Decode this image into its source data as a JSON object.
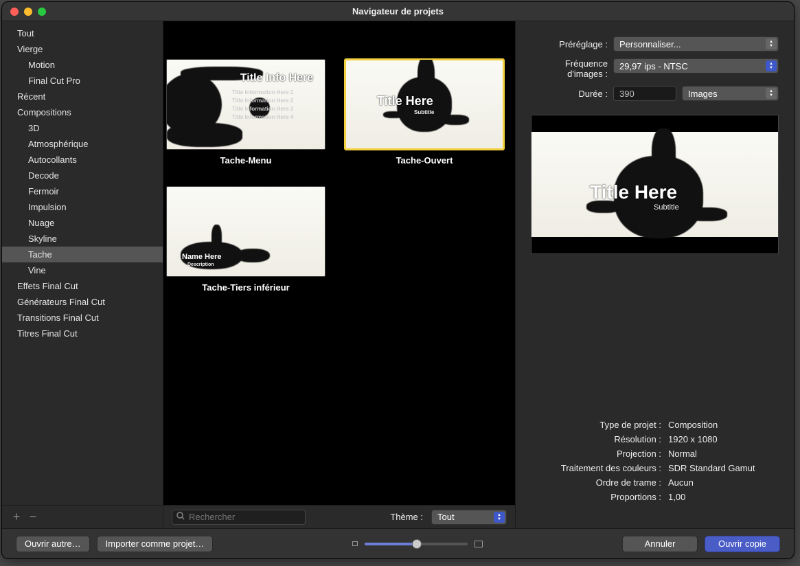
{
  "window_title": "Navigateur de projets",
  "sidebar": {
    "items": [
      {
        "label": "Tout",
        "level": 0,
        "selected": false
      },
      {
        "label": "Vierge",
        "level": 0,
        "selected": false
      },
      {
        "label": "Motion",
        "level": 1,
        "selected": false
      },
      {
        "label": "Final Cut Pro",
        "level": 1,
        "selected": false
      },
      {
        "label": "Récent",
        "level": 0,
        "selected": false
      },
      {
        "label": "Compositions",
        "level": 0,
        "selected": false
      },
      {
        "label": "3D",
        "level": 1,
        "selected": false
      },
      {
        "label": "Atmosphérique",
        "level": 1,
        "selected": false
      },
      {
        "label": "Autocollants",
        "level": 1,
        "selected": false
      },
      {
        "label": "Decode",
        "level": 1,
        "selected": false
      },
      {
        "label": "Fermoir",
        "level": 1,
        "selected": false
      },
      {
        "label": "Impulsion",
        "level": 1,
        "selected": false
      },
      {
        "label": "Nuage",
        "level": 1,
        "selected": false
      },
      {
        "label": "Skyline",
        "level": 1,
        "selected": false
      },
      {
        "label": "Tache",
        "level": 1,
        "selected": true
      },
      {
        "label": "Vine",
        "level": 1,
        "selected": false
      },
      {
        "label": "Effets Final Cut",
        "level": 0,
        "selected": false
      },
      {
        "label": "Générateurs Final Cut",
        "level": 0,
        "selected": false
      },
      {
        "label": "Transitions Final Cut",
        "level": 0,
        "selected": false
      },
      {
        "label": "Titres Final Cut",
        "level": 0,
        "selected": false
      }
    ]
  },
  "thumbnails": [
    {
      "label": "Tache-Menu",
      "title": "Title Info Here",
      "sublines": [
        "Title Information Here 1",
        "Title Information Here 2",
        "Title Information Here 3",
        "Title Information Here 4"
      ],
      "selected": false,
      "variant": "thumb1"
    },
    {
      "label": "Tache-Ouvert",
      "title": "Title Here",
      "subtitle": "Subtitle",
      "selected": true,
      "variant": "thumb2"
    },
    {
      "label": "Tache-Tiers inférieur",
      "title": "Name Here",
      "subtitle": "Description",
      "selected": false,
      "variant": "thumb3"
    }
  ],
  "search": {
    "placeholder": "Rechercher"
  },
  "theme": {
    "label": "Thème :",
    "value": "Tout"
  },
  "right": {
    "preset_label": "Préréglage :",
    "preset_value": "Personnaliser...",
    "fps_label": "Fréquence d'images :",
    "fps_value": "29,97 ips - NTSC",
    "duration_label": "Durée :",
    "duration_value": "390",
    "duration_unit": "Images",
    "preview_title": "Title Here",
    "preview_sub": "Subtitle",
    "meta": [
      {
        "label": "Type de projet :",
        "value": "Composition"
      },
      {
        "label": "Résolution :",
        "value": "1920 x 1080"
      },
      {
        "label": "Projection :",
        "value": "Normal"
      },
      {
        "label": "Traitement des couleurs :",
        "value": "SDR Standard Gamut"
      },
      {
        "label": "Ordre de trame :",
        "value": "Aucun"
      },
      {
        "label": "Proportions :",
        "value": "1,00"
      }
    ]
  },
  "bottom": {
    "open_other": "Ouvrir autre…",
    "import_project": "Importer comme projet…",
    "cancel": "Annuler",
    "open_copy": "Ouvrir copie"
  }
}
